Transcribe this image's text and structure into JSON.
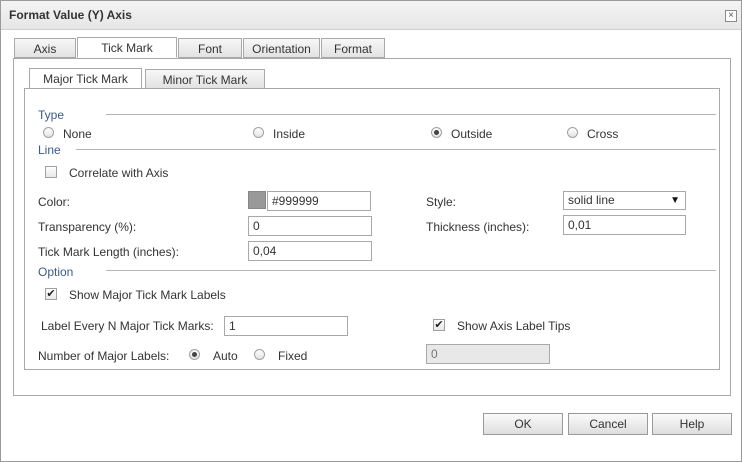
{
  "dialog": {
    "title": "Format Value (Y) Axis",
    "close_icon": "close-icon"
  },
  "tabs": [
    {
      "label": "Axis"
    },
    {
      "label": "Tick Mark",
      "active": true
    },
    {
      "label": "Font"
    },
    {
      "label": "Orientation"
    },
    {
      "label": "Format"
    }
  ],
  "subtabs": [
    {
      "label": "Major Tick Mark",
      "active": true
    },
    {
      "label": "Minor Tick Mark"
    }
  ],
  "type_section": {
    "title": "Type",
    "options": [
      "None",
      "Inside",
      "Outside",
      "Cross"
    ],
    "selected": "Outside"
  },
  "line_section": {
    "title": "Line",
    "correlate_label": "Correlate with Axis",
    "correlate_checked": false,
    "color_label": "Color:",
    "color_value": "#999999",
    "style_label": "Style:",
    "style_value": "solid line",
    "transparency_label": "Transparency (%):",
    "transparency_value": "0",
    "thickness_label": "Thickness (inches):",
    "thickness_value": "0,01",
    "length_label": "Tick Mark Length (inches):",
    "length_value": "0,04"
  },
  "option_section": {
    "title": "Option",
    "show_labels_label": "Show Major Tick Mark Labels",
    "show_labels_checked": true,
    "label_every_label": "Label Every N Major Tick Marks:",
    "label_every_value": "1",
    "show_tips_label": "Show Axis Label Tips",
    "show_tips_checked": true,
    "num_labels_label": "Number of Major Labels:",
    "num_labels_options": [
      "Auto",
      "Fixed"
    ],
    "num_labels_selected": "Auto",
    "fixed_value": "0"
  },
  "buttons": {
    "ok": "OK",
    "cancel": "Cancel",
    "help": "Help"
  },
  "colors": {
    "section_title": "#3a5a8c",
    "swatch": "#999999"
  }
}
